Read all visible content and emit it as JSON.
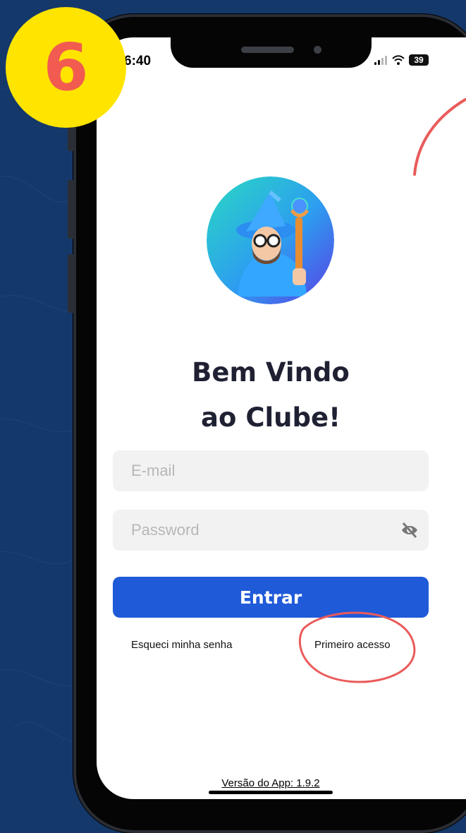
{
  "step_badge": {
    "number": "6"
  },
  "status_bar": {
    "time": "6:40",
    "battery": "39"
  },
  "welcome": {
    "line1": "Bem Vindo",
    "line2": "ao Clube!"
  },
  "form": {
    "email_placeholder": "E-mail",
    "password_placeholder": "Password",
    "submit_label": "Entrar"
  },
  "links": {
    "forgot_password": "Esqueci minha senha",
    "first_access": "Primeiro acesso"
  },
  "footer": {
    "version": "Versão do App: 1.9.2"
  },
  "colors": {
    "background": "#15386a",
    "badge": "#ffe400",
    "badge_text": "#f15b50",
    "button": "#1f5ad8",
    "annotation": "#ea5b5b"
  },
  "icons": {
    "password_visibility": "eye-slash-icon",
    "avatar": "wizard-avatar-icon"
  }
}
